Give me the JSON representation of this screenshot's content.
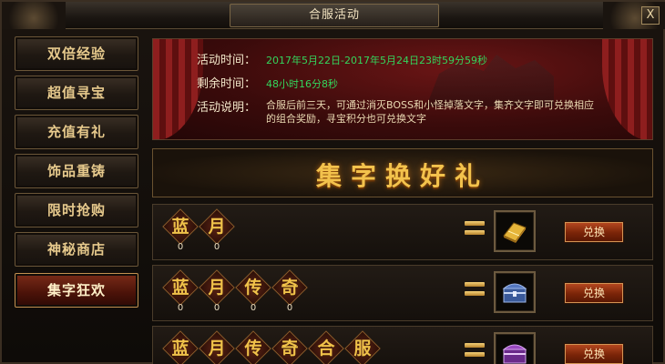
{
  "window": {
    "title": "合服活动",
    "close_label": "X"
  },
  "sidebar": {
    "items": [
      {
        "label": "双倍经验",
        "active": false
      },
      {
        "label": "超值寻宝",
        "active": false
      },
      {
        "label": "充值有礼",
        "active": false
      },
      {
        "label": "饰品重铸",
        "active": false
      },
      {
        "label": "限时抢购",
        "active": false
      },
      {
        "label": "神秘商店",
        "active": false
      },
      {
        "label": "集字狂欢",
        "active": true
      }
    ]
  },
  "info": {
    "time_label": "活动时间：",
    "time_value": "2017年5月22日-2017年5月24日23时59分59秒",
    "remain_label": "剩余时间：",
    "remain_value": "48小时16分8秒",
    "desc_label": "活动说明：",
    "desc_value": "合服后前三天，可通过消灭BOSS和小怪掉落文字，集齐文字即可兑换相应的组合奖励，寻宝积分也可兑换文字"
  },
  "exchange": {
    "title": "集字换好礼"
  },
  "rows": [
    {
      "chars": [
        {
          "c": "蓝",
          "count": "0"
        },
        {
          "c": "月",
          "count": "0"
        }
      ],
      "reward_icon": "gold-bar-icon",
      "button_label": "兑换"
    },
    {
      "chars": [
        {
          "c": "蓝",
          "count": "0"
        },
        {
          "c": "月",
          "count": "0"
        },
        {
          "c": "传",
          "count": "0"
        },
        {
          "c": "奇",
          "count": "0"
        }
      ],
      "reward_icon": "blue-chest-icon",
      "button_label": "兑换"
    },
    {
      "chars": [
        {
          "c": "蓝",
          "count": ""
        },
        {
          "c": "月",
          "count": ""
        },
        {
          "c": "传",
          "count": ""
        },
        {
          "c": "奇",
          "count": ""
        },
        {
          "c": "合",
          "count": ""
        },
        {
          "c": "服",
          "count": ""
        }
      ],
      "reward_icon": "purple-chest-icon",
      "button_label": "兑换"
    }
  ],
  "colors": {
    "accent_gold": "#f0c24a",
    "info_green": "#33d55c",
    "active_red": "#7a2b18"
  }
}
